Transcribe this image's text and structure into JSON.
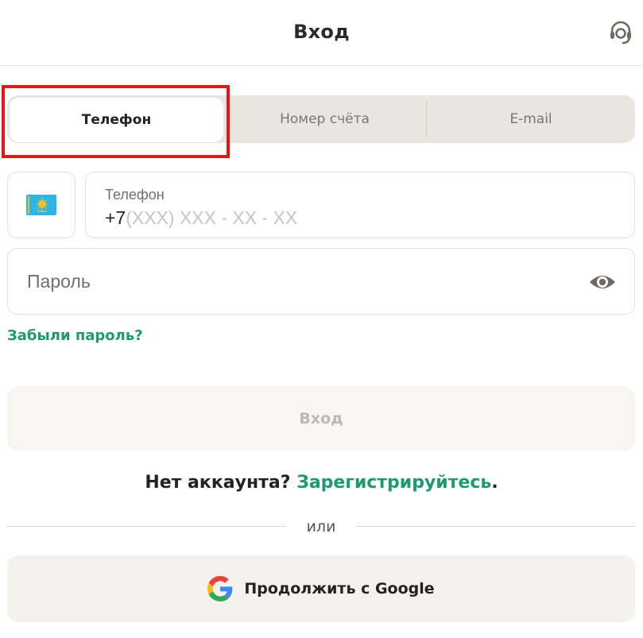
{
  "header": {
    "title": "Вход",
    "support_icon": "headset-icon"
  },
  "tabs": [
    {
      "label": "Телефон",
      "active": true
    },
    {
      "label": "Номер счёта",
      "active": false
    },
    {
      "label": "E-mail",
      "active": false
    }
  ],
  "country": {
    "flag_icon": "kazakhstan-flag-icon"
  },
  "phone": {
    "label": "Телефон",
    "prefix": "+7",
    "mask": "(XXX) XXX - XX - XX"
  },
  "password": {
    "placeholder": "Пароль",
    "visibility_icon": "eye-icon"
  },
  "forgot_link": "Забыли пароль?",
  "login_button": "Вход",
  "signup": {
    "text": "Нет аккаунта?",
    "link": "Зарегистрируйтесь",
    "end": "."
  },
  "divider_text": "или",
  "google_button": {
    "label": "Продолжить с Google",
    "icon": "google-icon"
  },
  "colors": {
    "accent": "#1f9a6e",
    "highlight": "#e8141a",
    "flag": "#2fb4e6",
    "sun": "#f4c51d"
  }
}
